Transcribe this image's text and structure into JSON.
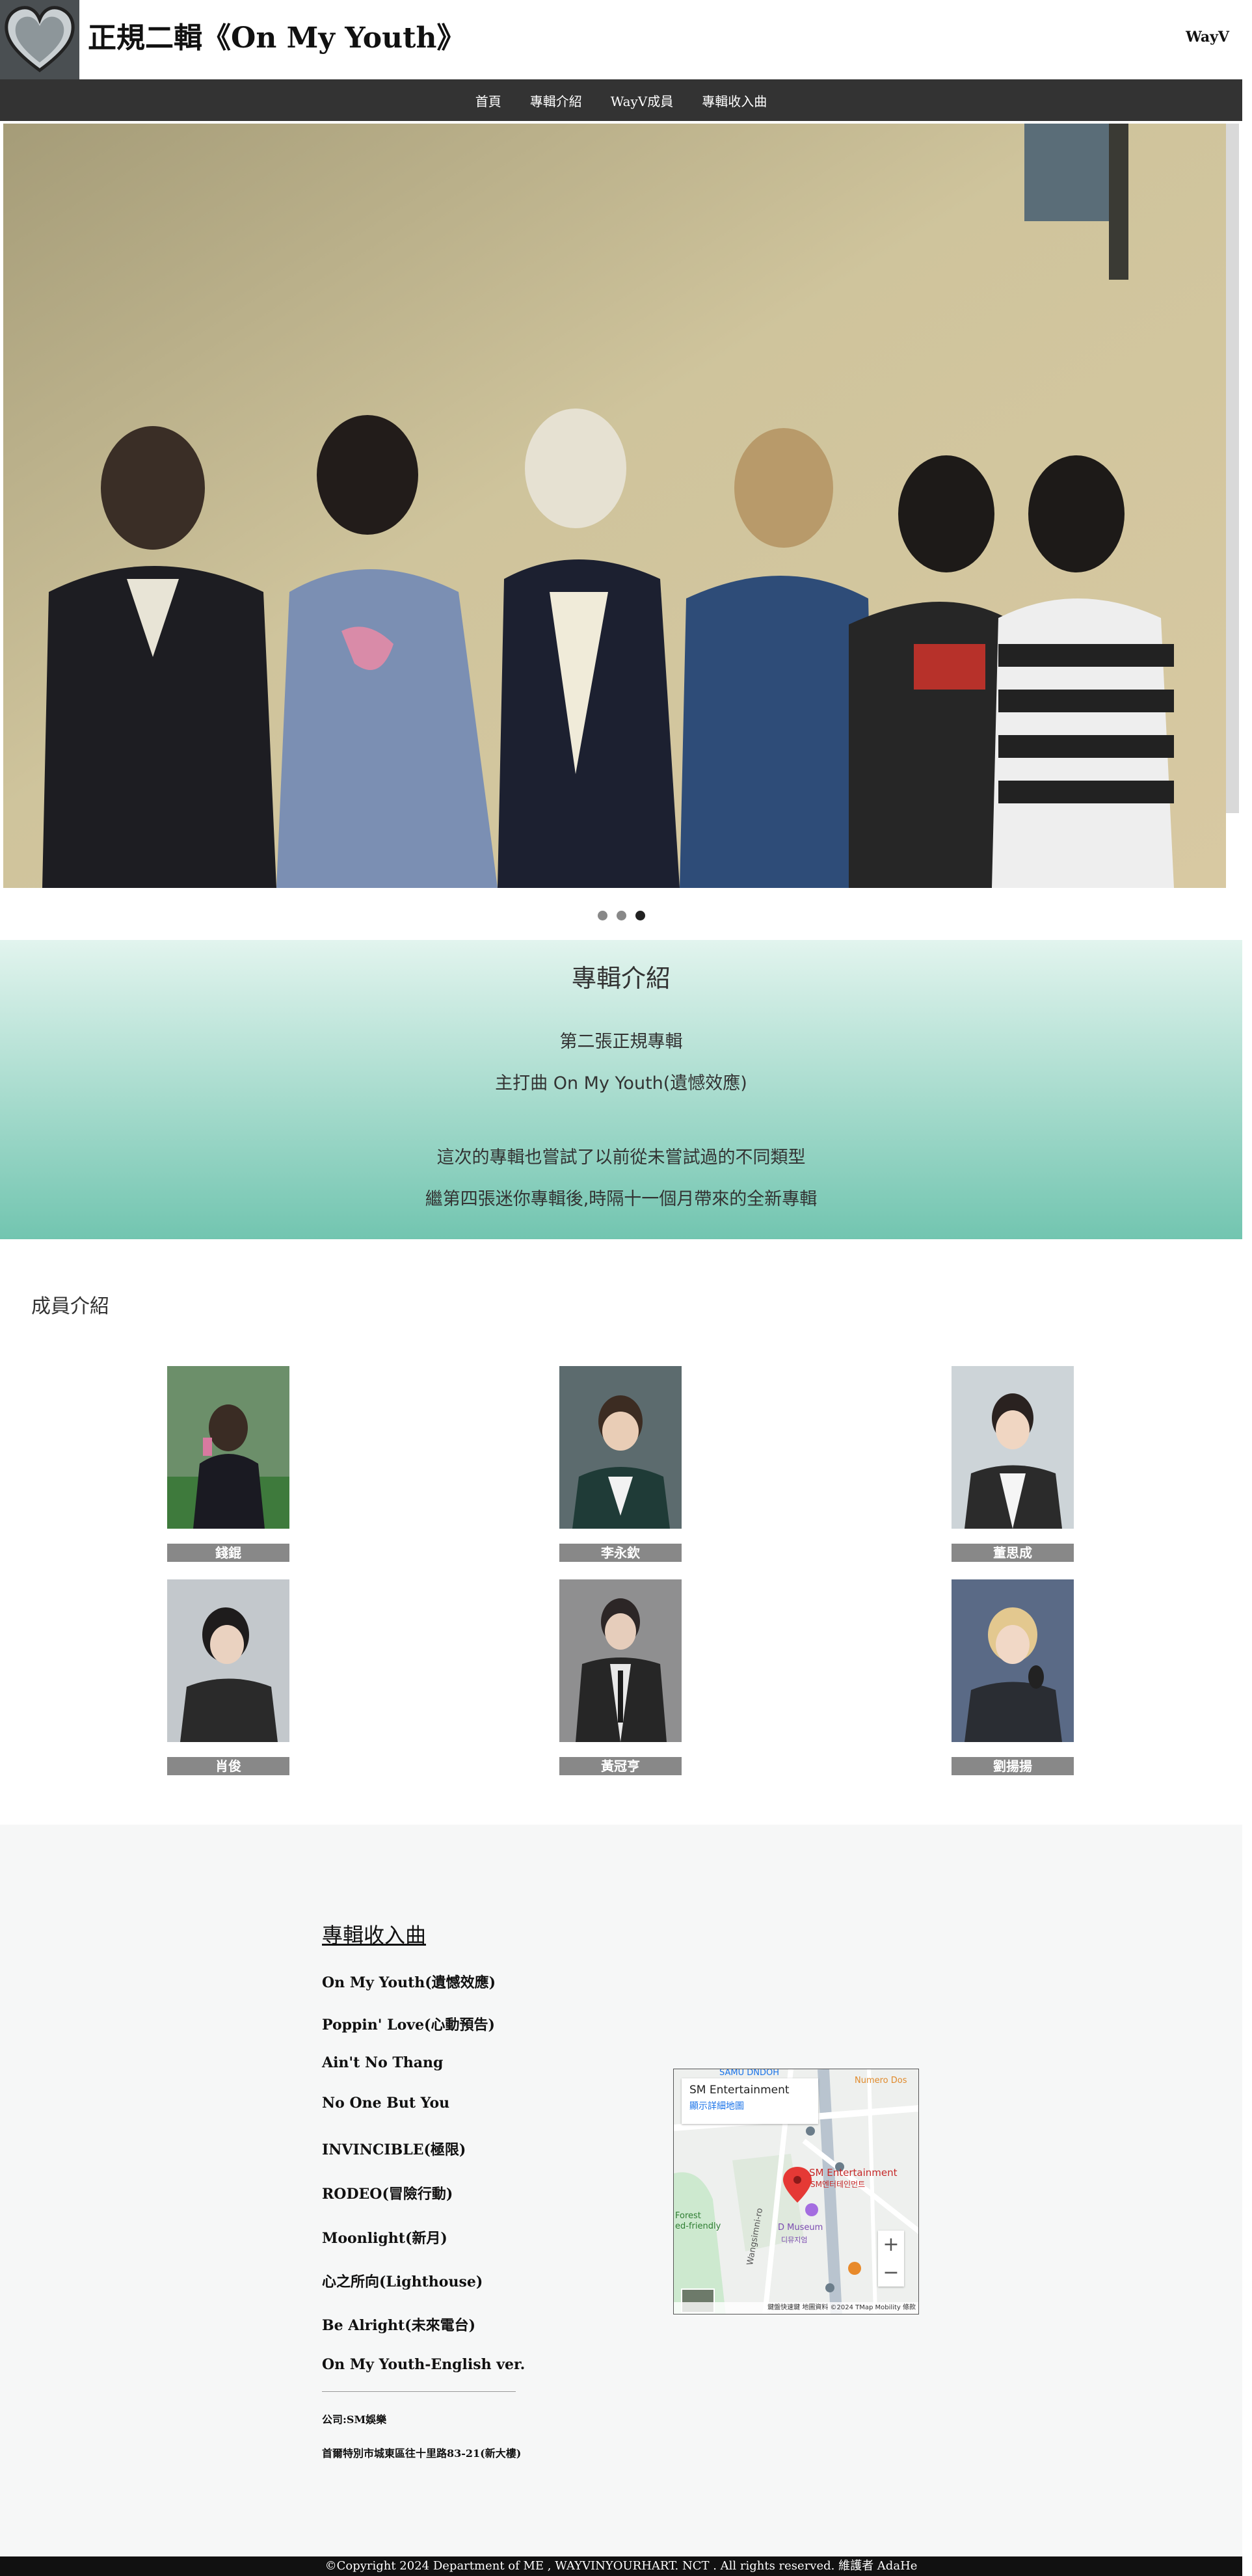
{
  "header": {
    "title": "正規二輯《On My Youth》",
    "brand": "WayV"
  },
  "nav": {
    "items": [
      "首頁",
      "專輯介紹",
      "WayV成員",
      "專輯收入曲"
    ]
  },
  "carousel": {
    "slide_count": 3,
    "active_index": 2
  },
  "intro": {
    "heading": "專輯介紹",
    "line1": "第二張正規專輯",
    "line2": "主打曲 On My Youth(遺憾效應)",
    "line3": "這次的專輯也嘗試了以前從未嘗試過的不同類型",
    "line4": "繼第四張迷你專輯後,時隔十一個月帶來的全新專輯"
  },
  "members": {
    "heading": "成員介紹",
    "list": [
      "錢錕",
      "李永欽",
      "董思成",
      "肖俊",
      "黃冠亨",
      "劉揚揚"
    ]
  },
  "tracks": {
    "heading": "專輯收入曲",
    "list": [
      "On My Youth(遺憾效應)",
      "Poppin' Love(心動預告)",
      "Ain't No Thang",
      "No One But You",
      "INVINCIBLE(極限)",
      "RODEO(冒險行動)",
      "Moonlight(新月)",
      "心之所向(Lighthouse)",
      "Be Alright(未來電台)",
      "On My Youth-English ver."
    ],
    "company": "公司:SM娛樂",
    "address": "首爾特別市城東區往十里路83-21(新大樓)"
  },
  "map": {
    "card_title": "SM Entertainment",
    "card_link": "顯示詳細地圖",
    "pin_label": "SM Entertainment",
    "pin_sublabel": "SM엔터테인먼트",
    "poi_museum": "D Museum",
    "poi_museum_kr": "디뮤지엄",
    "poi_top": "SAMU DNDOH",
    "poi_numero": "Numero Dos",
    "poi_forest": "Forest",
    "poi_forest2": "ed-friendly",
    "road": "Wangsimni-ro",
    "attribution": "鍵盤快速鍵  地圖資料 ©2024 TMap Mobility  條款"
  },
  "footer": {
    "text": "©Copyright 2024 Department of ME , WAYVINYOURHART. NCT . All rights reserved. 維護者 AdaHe"
  },
  "colors": {
    "nav_bg": "#333333",
    "intro_top": "#e2f4ee",
    "intro_bottom": "#72c5b0",
    "name_tag": "#888888",
    "footer_bg": "#111111"
  }
}
